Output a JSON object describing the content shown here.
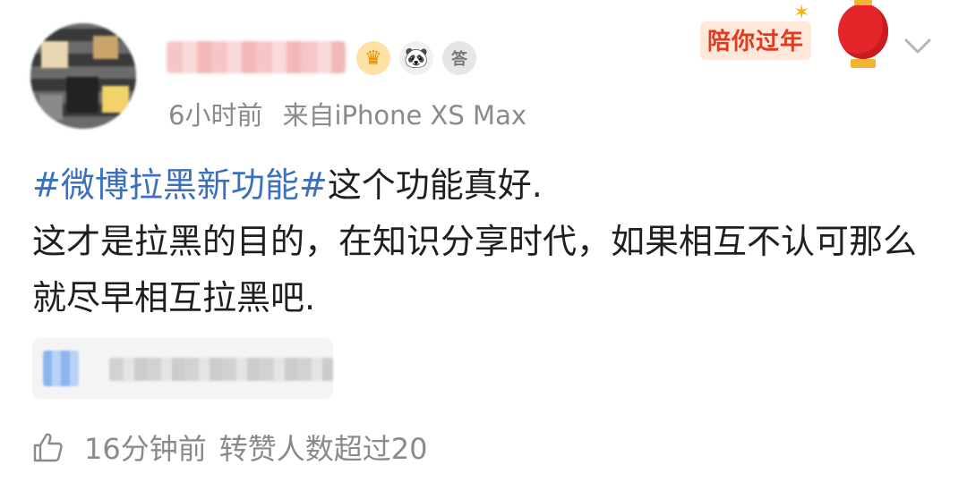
{
  "post": {
    "time": "6小时前",
    "source": "来自iPhone XS Max",
    "badges": {
      "crown": "crown-icon",
      "panda": "panda-icon",
      "medal": "medal-icon",
      "medal_text": "答"
    },
    "promo_text": "陪你过年",
    "topic": "#微博拉黑新功能#",
    "text_after_topic": "这个功能真好.",
    "text_line2": "这才是拉黑的目的，在知识分享时代，如果相互不认可那么就尽早相互拉黑吧."
  },
  "footer": {
    "time": "16分钟前",
    "repost_text": "转赞人数超过20"
  },
  "colors": {
    "topic": "#3b6fbf",
    "meta": "#8a8a8a",
    "promo": "#e23a22"
  }
}
